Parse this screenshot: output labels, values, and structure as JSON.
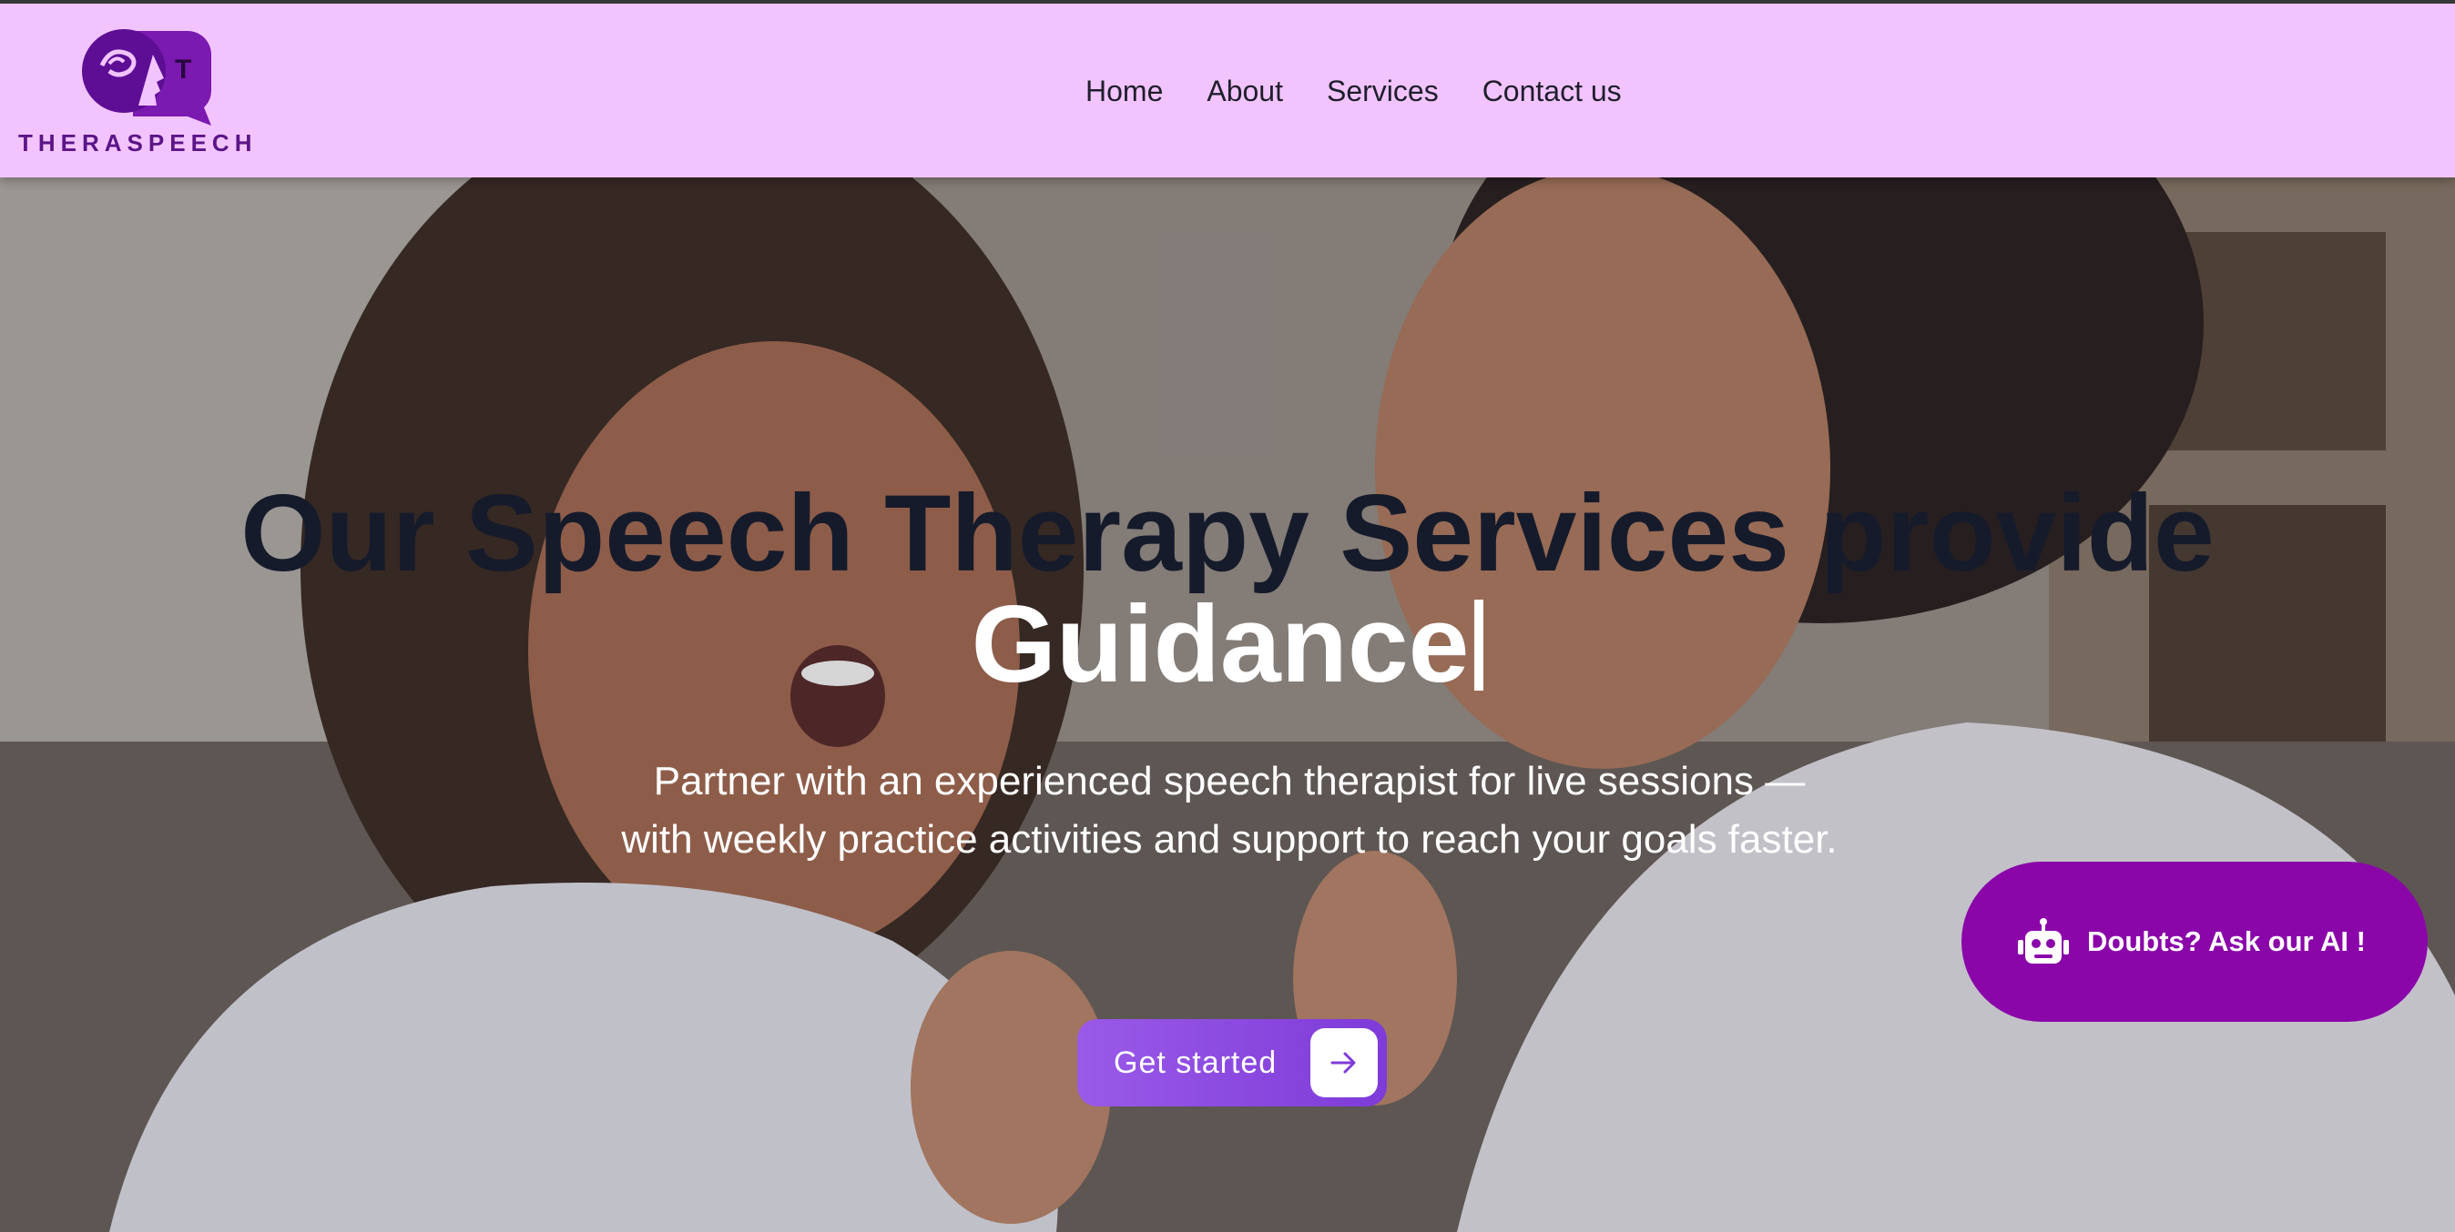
{
  "header": {
    "brand": "THERASPEECH",
    "logo_letter": "T",
    "nav": [
      {
        "label": "Home"
      },
      {
        "label": "About"
      },
      {
        "label": "Services"
      },
      {
        "label": "Contact us"
      }
    ]
  },
  "hero": {
    "headline_line1": "Our Speech Therapy Services provide",
    "headline_line2": "Guidance",
    "subtitle": "Partner with an experienced speech therapist for live sessions — with weekly practice activities and support to reach your goals faster.",
    "cta_label": "Get started"
  },
  "ai_chat": {
    "label": "Doubts? Ask our AI !"
  },
  "colors": {
    "header_bg": "#f2c4ff",
    "brand_purple": "#5b1587",
    "cta_purple": "#8b4ae0",
    "ai_button": "#8a06a9"
  },
  "icons": [
    "logo-icon",
    "arrow-right-icon",
    "robot-icon"
  ]
}
